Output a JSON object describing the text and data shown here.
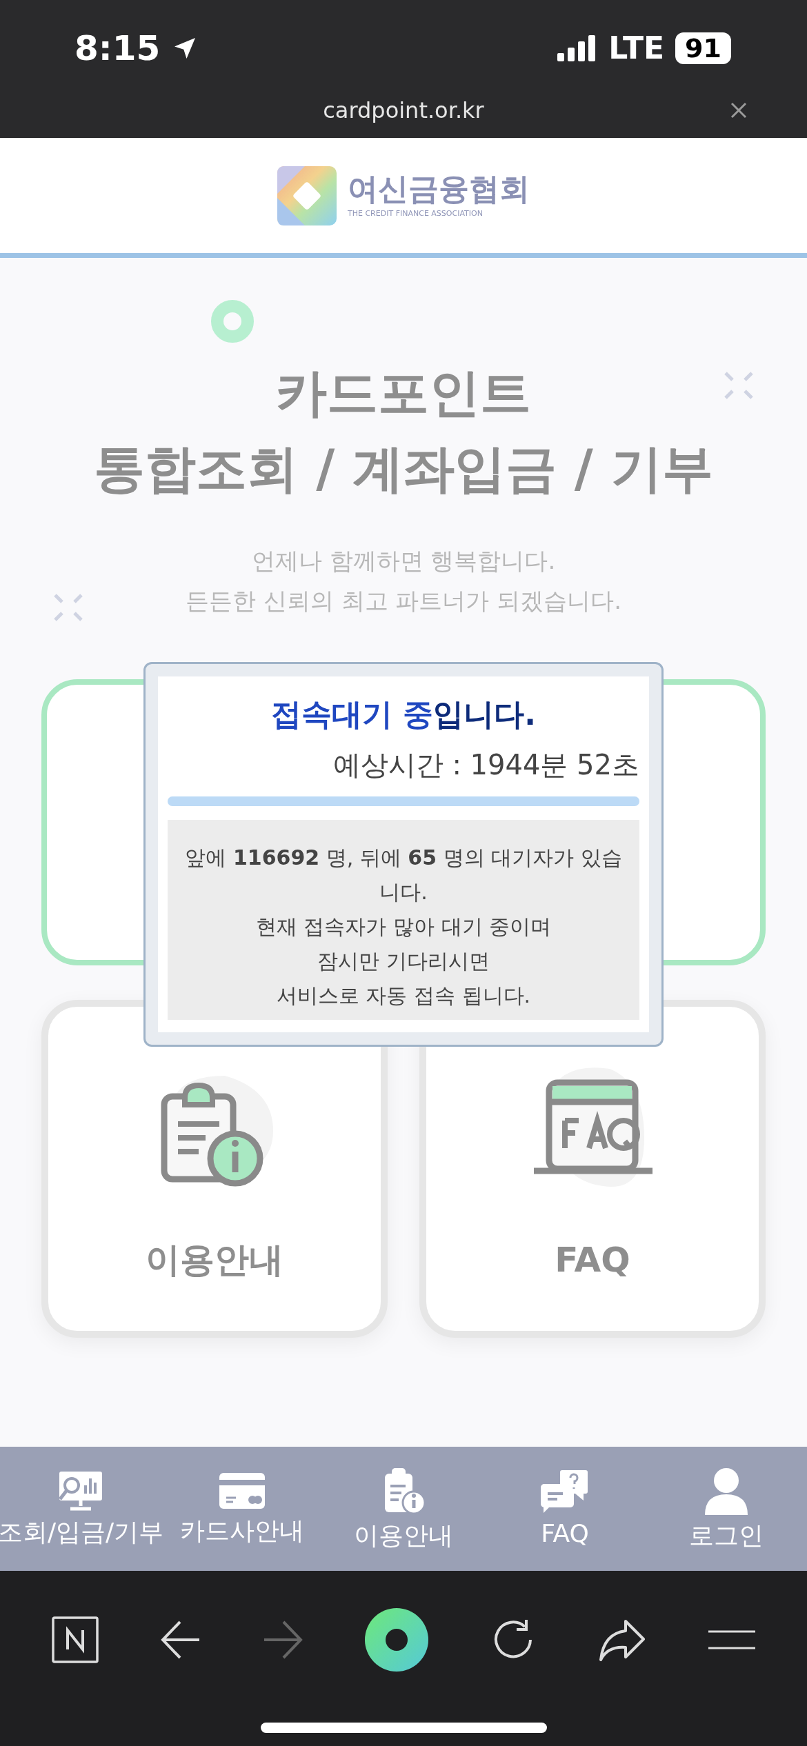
{
  "status_bar": {
    "time": "8:15",
    "network": "LTE",
    "battery": "91"
  },
  "browser": {
    "url": "cardpoint.or.kr"
  },
  "logo": {
    "name_ko": "여신금융협회",
    "name_en": "THE CREDIT FINANCE ASSOCIATION"
  },
  "hero": {
    "title_lines": [
      "카드포인트",
      "통합조회 / 계좌입금 / 기부"
    ],
    "subtitle_lines": [
      "언제나 함께하면 행복합니다.",
      "든든한 신뢰의 최고 파트너가 되겠습니다."
    ]
  },
  "menu_cards": [
    {
      "label": "이용안내",
      "kind": "guide"
    },
    {
      "label": "FAQ",
      "kind": "faq"
    }
  ],
  "popup": {
    "title": "접속대기 중",
    "title_rest": "입니다.",
    "estimate": "예상시간 : 1944분 52초",
    "level": 1,
    "message": "앞에 **116692** 명, 뒤에 **65** 명의 대기자가 있습니다.",
    "notes": [
      "현재 접속자가 많아 대기 중이며",
      "잠시만 기다리시면",
      "서비스로 자동 접속 됩니다."
    ]
  },
  "bottom_nav": [
    {
      "label": "조회/입금/기부",
      "kind": "search"
    },
    {
      "label": "카드사안내",
      "kind": "card"
    },
    {
      "label": "이용안내",
      "kind": "guide"
    },
    {
      "label": "FAQ",
      "kind": "faq"
    },
    {
      "label": "로그인",
      "kind": "login"
    }
  ],
  "toolbar": [
    {
      "kind": "naver",
      "disabled": false
    },
    {
      "kind": "back",
      "disabled": false
    },
    {
      "kind": "forward",
      "disabled": true
    },
    {
      "kind": "home",
      "disabled": false
    },
    {
      "kind": "reload",
      "disabled": false
    },
    {
      "kind": "share",
      "disabled": false
    },
    {
      "kind": "menu",
      "disabled": false
    }
  ]
}
